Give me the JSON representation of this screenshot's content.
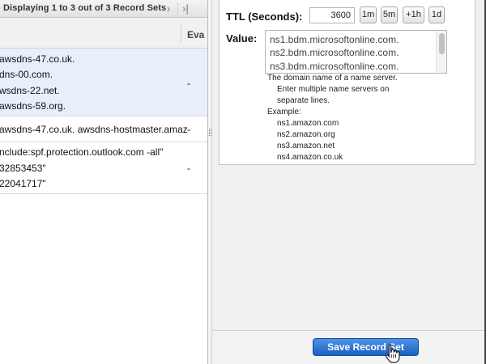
{
  "records_pane": {
    "pager_text": "Displaying 1 to 3 out of 3 Record Sets",
    "next_icon": "›",
    "last_icon": "›|",
    "column_eval_header": "Eva",
    "rows": [
      {
        "lines": [
          "awsdns-47.co.uk.",
          "dns-00.com.",
          "wsdns-22.net.",
          "awsdns-59.org."
        ],
        "evaluate": "-"
      },
      {
        "lines": [
          "awsdns-47.co.uk. awsdns-hostmaster.amaz"
        ],
        "evaluate": "-"
      },
      {
        "lines": [
          "nclude:spf.protection.outlook.com -all\"",
          "32853453\"",
          "22041717\""
        ],
        "evaluate": "-"
      }
    ]
  },
  "edit_form": {
    "ttl_label": "TTL (Seconds):",
    "ttl_value": "3600",
    "ttl_buttons": [
      "1m",
      "5m",
      "+1h",
      "1d"
    ],
    "value_label": "Value:",
    "value_lines": [
      "ns1.bdm.microsoftonline.com.",
      "ns2.bdm.microsoftonline.com.",
      "ns3.bdm.microsoftonline.com."
    ],
    "help_lines": [
      "The domain name of a name server.",
      "Enter multiple name servers on",
      "separate lines.",
      "Example:",
      "ns1.amazon.com",
      "ns2.amazon.org",
      "ns3.amazon.net",
      "ns4.amazon.co.uk"
    ],
    "save_label": "Save Record Set"
  },
  "colors": {
    "selected_row": "#e8effb",
    "save_button": "#1b5fc0"
  }
}
